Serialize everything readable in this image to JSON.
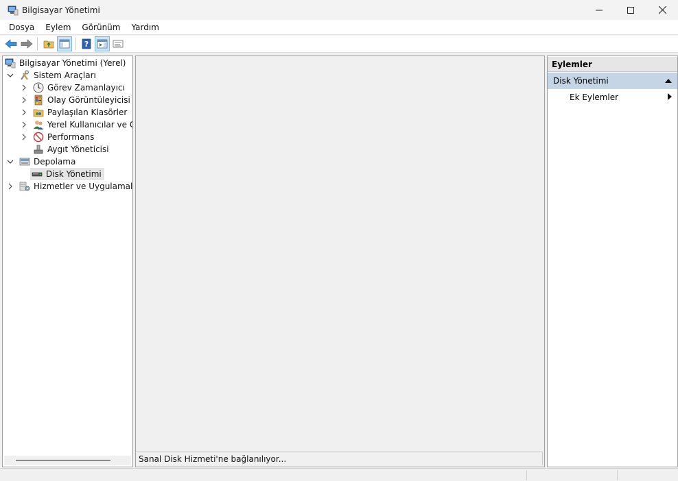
{
  "window": {
    "title": "Bilgisayar Yönetimi",
    "icon": "computer-management-icon"
  },
  "menu": [
    "Dosya",
    "Eylem",
    "Görünüm",
    "Yardım"
  ],
  "toolbar": {
    "buttons": [
      "back-arrow-icon",
      "forward-arrow-icon",
      "up-folder-icon",
      "show-hide-tree-icon",
      "help-icon",
      "show-hide-action-pane-icon",
      "properties-icon"
    ]
  },
  "tree": {
    "root": "Bilgisayar Yönetimi (Yerel)",
    "items": [
      {
        "label": "Sistem Araçları",
        "icon": "tools-icon"
      },
      {
        "label": "Görev Zamanlayıcı",
        "icon": "clock-icon"
      },
      {
        "label": "Olay Görüntüleyicisi",
        "icon": "event-viewer-icon"
      },
      {
        "label": "Paylaşılan Klasörler",
        "icon": "shared-folder-icon"
      },
      {
        "label": "Yerel Kullanıcılar ve Gru",
        "icon": "users-icon"
      },
      {
        "label": "Performans",
        "icon": "performance-icon"
      },
      {
        "label": "Aygıt Yöneticisi",
        "icon": "device-manager-icon"
      },
      {
        "label": "Depolama",
        "icon": "storage-icon"
      },
      {
        "label": "Disk Yönetimi",
        "icon": "disk-icon"
      },
      {
        "label": "Hizmetler ve Uygulamalar",
        "icon": "services-icon"
      }
    ]
  },
  "center": {
    "status": "Sanal Disk Hizmeti'ne bağlanılıyor..."
  },
  "actions": {
    "header": "Eylemler",
    "section": "Disk Yönetimi",
    "item": "Ek Eylemler"
  }
}
